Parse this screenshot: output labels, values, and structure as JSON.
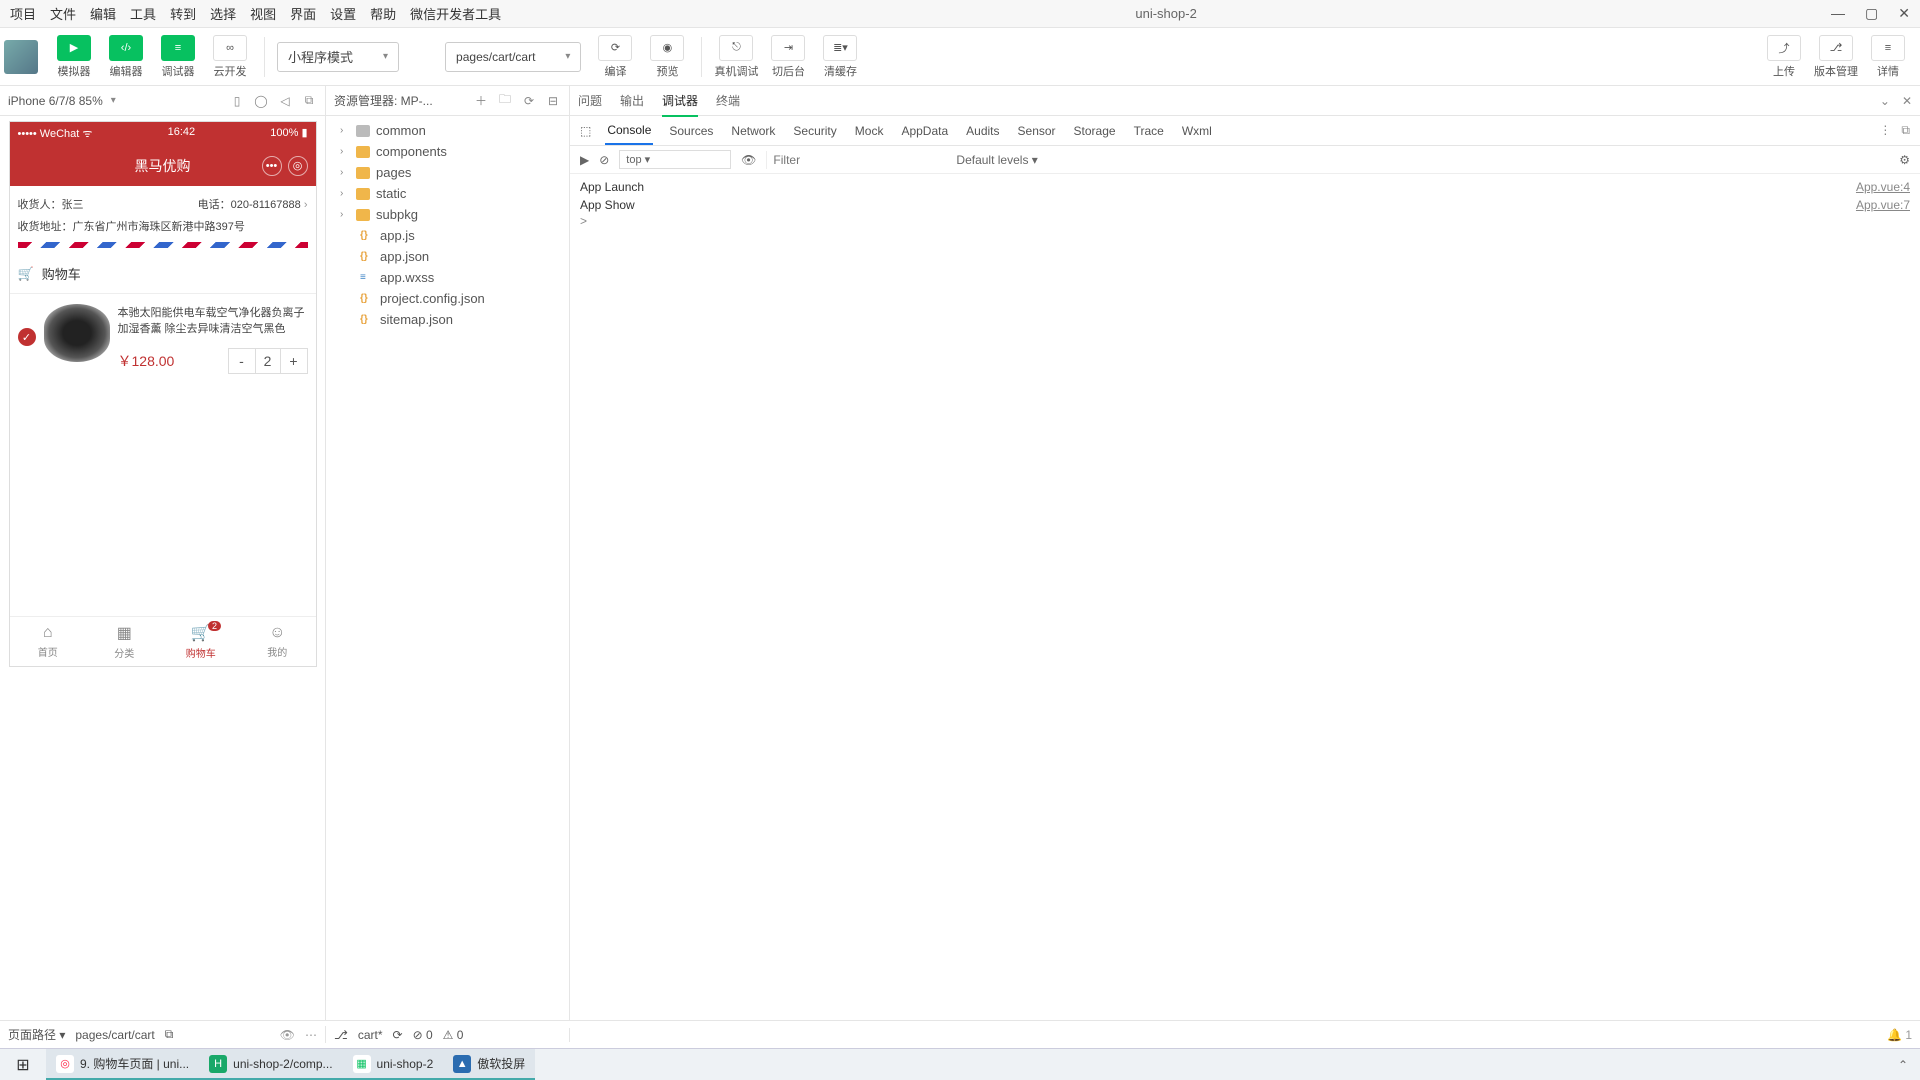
{
  "menu": {
    "items": [
      "项目",
      "文件",
      "编辑",
      "工具",
      "转到",
      "选择",
      "视图",
      "界面",
      "设置",
      "帮助",
      "微信开发者工具"
    ],
    "title": "uni-shop-2"
  },
  "win": {
    "min": "—",
    "max": "▢",
    "close": "✕"
  },
  "toolbar": {
    "sim": "模拟器",
    "editor": "编辑器",
    "debugger": "调试器",
    "cloud": "云开发",
    "mode": "小程序模式",
    "page": "pages/cart/cart",
    "compile": "编译",
    "preview": "预览",
    "realdev": "真机调试",
    "background": "切后台",
    "clearcache": "清缓存",
    "upload": "上传",
    "version": "版本管理",
    "detail": "详情"
  },
  "device": {
    "label": "iPhone 6/7/8 85%"
  },
  "explorer": {
    "title": "资源管理器: MP-...",
    "folders": [
      "common",
      "components",
      "pages",
      "static",
      "subpkg"
    ],
    "files": [
      "app.js",
      "app.json",
      "app.wxss",
      "project.config.json",
      "sitemap.json"
    ]
  },
  "dtabs": {
    "items": [
      "问题",
      "输出",
      "调试器",
      "终端"
    ],
    "active": "调试器"
  },
  "devtoolbar": {
    "items": [
      "Console",
      "Sources",
      "Network",
      "Security",
      "Mock",
      "AppData",
      "Audits",
      "Sensor",
      "Storage",
      "Trace",
      "Wxml"
    ],
    "active": "Console"
  },
  "dfilter": {
    "context": "top",
    "placeholder": "Filter",
    "levels": "Default levels"
  },
  "console": {
    "lines": [
      {
        "msg": "App Launch",
        "src": "App.vue:4"
      },
      {
        "msg": "App Show",
        "src": "App.vue:7"
      }
    ],
    "prompt": ">"
  },
  "phone": {
    "carrier": "••••• WeChat",
    "sig": "ᯤ",
    "time": "16:42",
    "batt": "100%",
    "title": "黑马优购",
    "recipient_label": "收货人：",
    "recipient": "张三",
    "tel_label": "电话：",
    "tel": "020-81167888",
    "addr_label": "收货地址：",
    "addr": "广东省广州市海珠区新港中路397号",
    "cart_header": "购物车",
    "item_title": "本驰太阳能供电车载空气净化器负离子加湿香薰 除尘去异味清洁空气黑色",
    "price": "￥128.00",
    "qty": "2",
    "tabs": [
      {
        "label": "首页"
      },
      {
        "label": "分类"
      },
      {
        "label": "购物车",
        "badge": "2"
      },
      {
        "label": "我的"
      }
    ]
  },
  "foot": {
    "pathlabel": "页面路径",
    "path": "pages/cart/cart",
    "branch": "cart*",
    "err": "0",
    "warn": "0",
    "bell": "1"
  },
  "taskbar": {
    "items": [
      {
        "label": "9. 购物车页面 | uni...",
        "color": "#f2c94c"
      },
      {
        "label": "uni-shop-2/comp...",
        "color": "#19a869"
      },
      {
        "label": "uni-shop-2",
        "color": "#07c160"
      },
      {
        "label": "傲软投屏",
        "color": "#2b6cb0"
      }
    ]
  }
}
